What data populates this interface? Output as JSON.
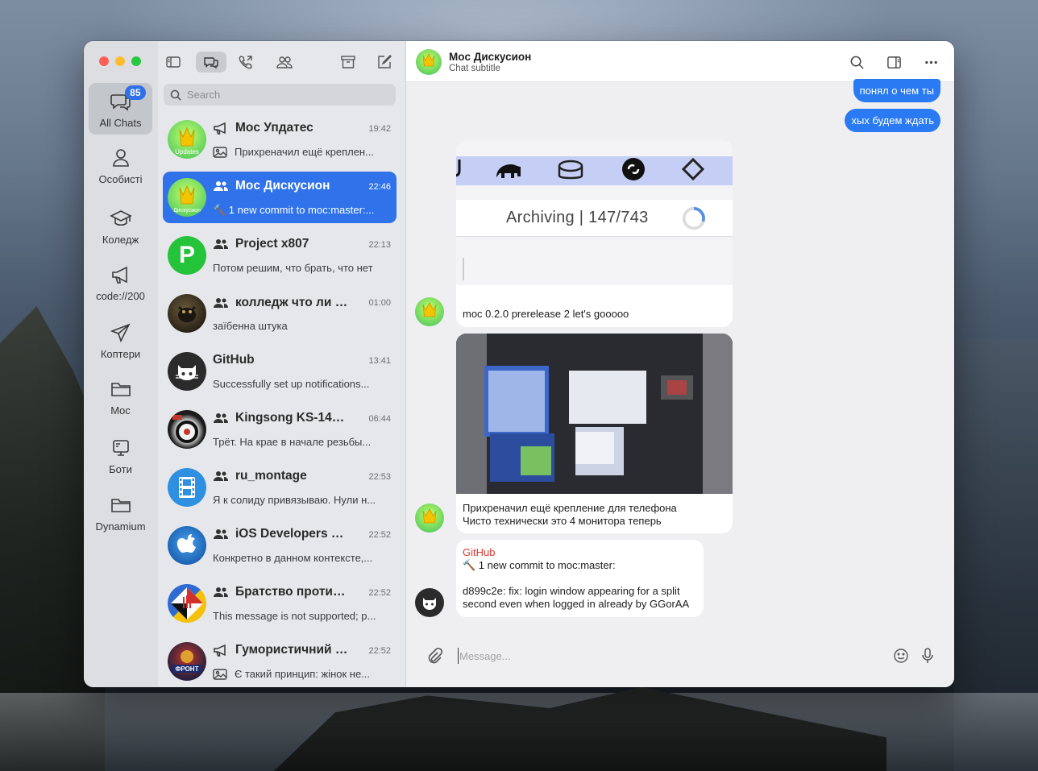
{
  "rail": {
    "folders": [
      {
        "label": "All Chats",
        "icon": "chats-icon",
        "badge": "85",
        "active": true
      },
      {
        "label": "Особисті",
        "icon": "person-icon"
      },
      {
        "label": "Коледж",
        "icon": "graduation-cap-icon"
      },
      {
        "label": "code://200",
        "icon": "megaphone-icon"
      },
      {
        "label": "Коптери",
        "icon": "paper-plane-icon"
      },
      {
        "label": "Moc",
        "icon": "folder-icon"
      },
      {
        "label": "Боти",
        "icon": "bot-icon"
      },
      {
        "label": "Dynamium",
        "icon": "folder-icon"
      }
    ]
  },
  "search": {
    "placeholder": "Search"
  },
  "chats": [
    {
      "title": "Moc Упдатес",
      "type": "channel",
      "time": "19:42",
      "preview": "Прихреначил ещё креплен...",
      "preview_icon": "image-icon",
      "avatar": "moc-updates"
    },
    {
      "title": "Moc Дискусион",
      "type": "group",
      "time": "22:46",
      "preview": "🔨 1 new commit to moc:master:...",
      "avatar": "moc-discussion",
      "selected": true
    },
    {
      "title": "Project x807",
      "type": "group",
      "time": "22:13",
      "preview": "Потом решим, что брать, что нет",
      "avatar_letter": "P",
      "avatar": "letter"
    },
    {
      "title": "колледж что ли 😋...",
      "type": "group",
      "time": "01:00",
      "preview": "заїбенна штука",
      "avatar": "photo-dark"
    },
    {
      "title": "GitHub",
      "type": "bot",
      "time": "13:41",
      "preview": "Successfully set up notifications...",
      "avatar": "github"
    },
    {
      "title": "Kingsong KS-14M...",
      "type": "group",
      "time": "06:44",
      "preview": "Трёт. На крае в начале резьбы...",
      "avatar": "photo-wheel"
    },
    {
      "title": "ru_montage",
      "type": "group",
      "time": "22:53",
      "preview": "Я к солиду привязываю.  Нули н...",
      "avatar": "film"
    },
    {
      "title": "iOS Developers —...",
      "type": "group",
      "time": "22:52",
      "preview": "Конкретно в данном контексте,...",
      "avatar": "apple"
    },
    {
      "title": "Братство против...",
      "type": "group",
      "time": "22:52",
      "preview": "This message is not supported; p...",
      "avatar": "flag"
    },
    {
      "title": "Гумористичний ф...",
      "type": "channel",
      "time": "22:52",
      "preview": "Є такий принцип: жінок не...",
      "preview_icon": "image-icon",
      "avatar": "front"
    }
  ],
  "header": {
    "title": "Moc Дискусион",
    "subtitle": "Chat subtitle"
  },
  "messages": {
    "out1": "понял о чем ты",
    "out2": "хых будем ждать",
    "screenshot_text": "Archiving | 147/743",
    "caption1": "moc 0.2.0 prerelease 2 let's gooooo",
    "caption2_line1": "Прихреначил ещё крепление для телефона",
    "caption2_line2": "Чисто технически это 4 монитора теперь",
    "gh_sender": "GitHub",
    "gh_line1": "🔨 1 new commit to moc:master:",
    "gh_line2": "d899c2e: fix: login window appearing for a split",
    "gh_line3": "second even when logged in already by GGorAA"
  },
  "composer": {
    "placeholder": "Message..."
  },
  "avatar_labels": {
    "updates": "Updates",
    "discussion": "Дискусион",
    "front": "ФРОНТ"
  },
  "colors": {
    "accent": "#2f72ea",
    "bubble_out": "#2a7bf3",
    "badge": "#2f6fe8",
    "github_sender": "#e0382e"
  }
}
